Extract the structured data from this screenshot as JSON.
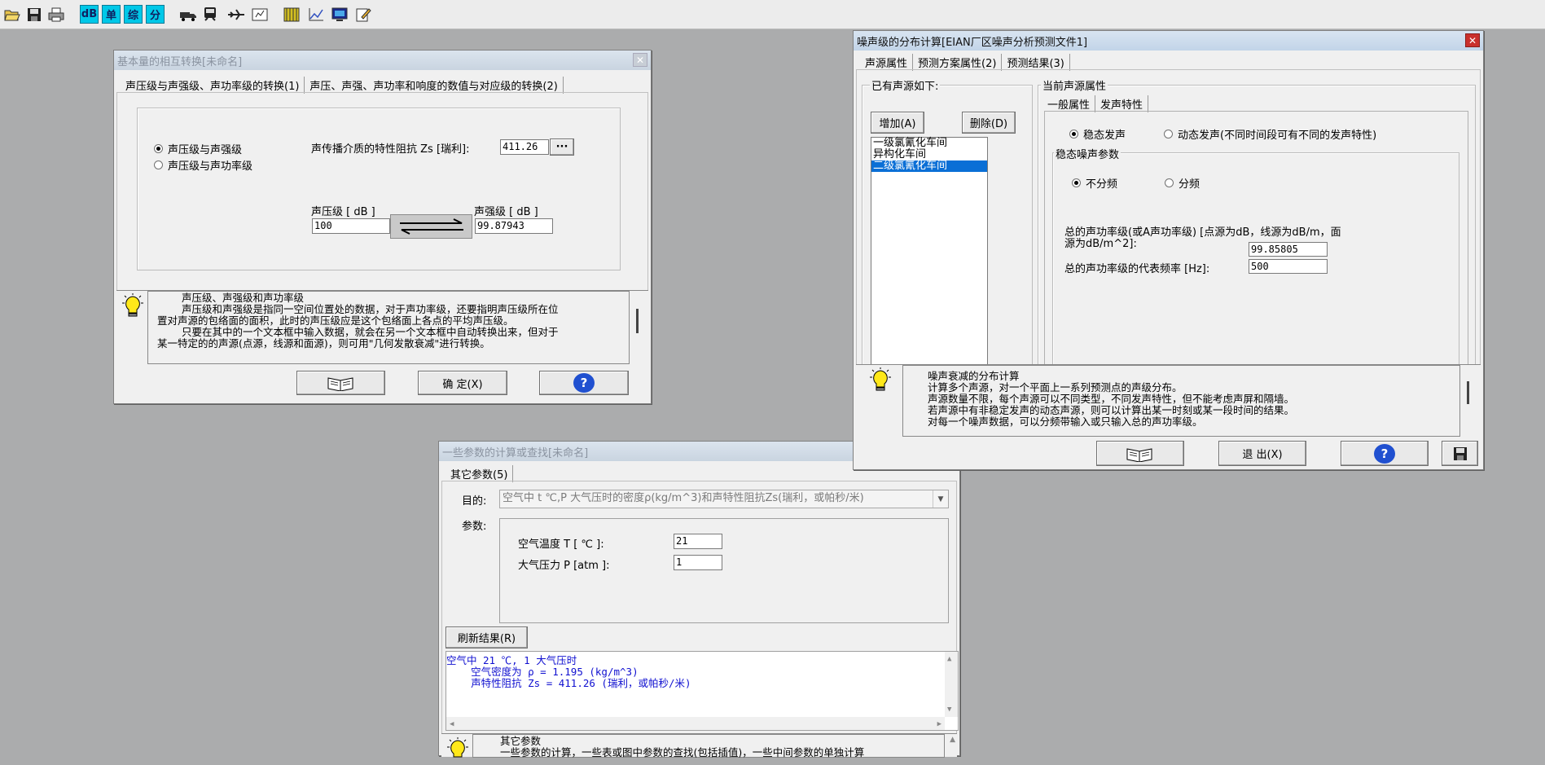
{
  "toolbar": {
    "icons": [
      "open-folder-icon",
      "save-icon",
      "print-icon",
      "db-icon",
      "single-icon",
      "composite-icon",
      "split-icon",
      "truck-icon",
      "train-icon",
      "aircraft-icon",
      "report-icon",
      "ruler-icon",
      "chart-icon",
      "monitor-icon",
      "notepad-icon"
    ],
    "db_label": "dB",
    "dan_label": "单",
    "zong_label": "综",
    "fen_label": "分"
  },
  "win1": {
    "title": "基本量的相互转换[未命名]",
    "tabs": [
      "声压级与声强级、声功率级的转换(1)",
      "声压、声强、声功率和响度的数值与对应级的转换(2)"
    ],
    "radio1": "声压级与声强级",
    "radio2": "声压级与声功率级",
    "impedance_label": "声传播介质的特性阻抗 Zs [瑞利]:",
    "impedance_value": "411.26",
    "browse_label": "···",
    "spl_label": "声压级 [ dB ]",
    "spl_value": "100",
    "sil_label": "声强级 [ dB ]",
    "sil_value": "99.87943",
    "help_title": "声压级、声强级和声功率级",
    "help_line1": "声压级和声强级是指同一空间位置处的数据，对于声功率级，还要指明声压级所在位",
    "help_line2": "置对声源的包络面的面积，此时的声压级应是这个包络面上各点的平均声压级。",
    "help_line3": "只要在其中的一个文本框中输入数据，就会在另一个文本框中自动转换出来，但对于",
    "help_line4": "某一特定的的声源(点源，线源和面源)，则可用\"几何发散衰减\"进行转换。",
    "ok_label": "确 定(X)",
    "help_q": "?"
  },
  "win2": {
    "title": "噪声级的分布计算[EIAN厂区噪声分析预测文件1]",
    "tabs": [
      "声源属性",
      "预测方案属性(2)",
      "预测结果(3)"
    ],
    "sources_group": "已有声源如下:",
    "add_label": "增加(A)",
    "delete_label": "删除(D)",
    "sources": [
      "一级氯氰化车间",
      "异构化车间",
      "二级氯氰化车间"
    ],
    "current_group": "当前声源属性",
    "subtabs": [
      "一般属性",
      "发声特性"
    ],
    "radio_steady": "稳态发声",
    "radio_dynamic": "动态发声(不同时间段可有不同的发声特性)",
    "steady_group": "稳态噪声参数",
    "radio_nofreq": "不分频",
    "radio_freq": "分频",
    "power_label1": "总的声功率级(或A声功率级) [点源为dB，线源为dB/m，面",
    "power_label2": "源为dB/m^2]:",
    "power_value": "99.85805",
    "freq_label": "总的声功率级的代表频率  [Hz]:",
    "freq_value": "500",
    "help_title": "噪声衰减的分布计算",
    "help_line1": "计算多个声源，对一个平面上一系列预测点的声级分布。",
    "help_line2": "声源数量不限，每个声源可以不同类型，不同发声特性，但不能考虑声屏和隔墙。",
    "help_line3": "若声源中有非稳定发声的动态声源，则可以计算出某一时刻或某一段时间的结果。",
    "help_line4": "对每一个噪声数据，可以分频带输入或只输入总的声功率级。",
    "exit_label": "退 出(X)",
    "help_q": "?"
  },
  "win3": {
    "title": "一些参数的计算或查找[未命名]",
    "tab": "其它参数(5)",
    "purpose_label": "目的:",
    "purpose_value": "空气中 t ℃,P 大气压时的密度ρ(kg/m^3)和声特性阻抗Zs(瑞利，或帕秒/米)",
    "params_label": "参数:",
    "temp_label": "空气温度 T [ ℃ ]:",
    "temp_value": "21",
    "pressure_label": "大气压力 P [atm ]:",
    "pressure_value": "1",
    "refresh_label": "刷新结果(R)",
    "result_line1": "空气中 21 ℃, 1 大气压时",
    "result_line2": "    空气密度为 ρ = 1.195 (kg/m^3)",
    "result_line3": "    声特性阻抗 Zs = 411.26 (瑞利，或帕秒/米)",
    "help_title": "其它参数",
    "help_line1": "一些参数的计算，一些表或图中参数的查找(包括插值)，一些中间参数的单独计算"
  }
}
